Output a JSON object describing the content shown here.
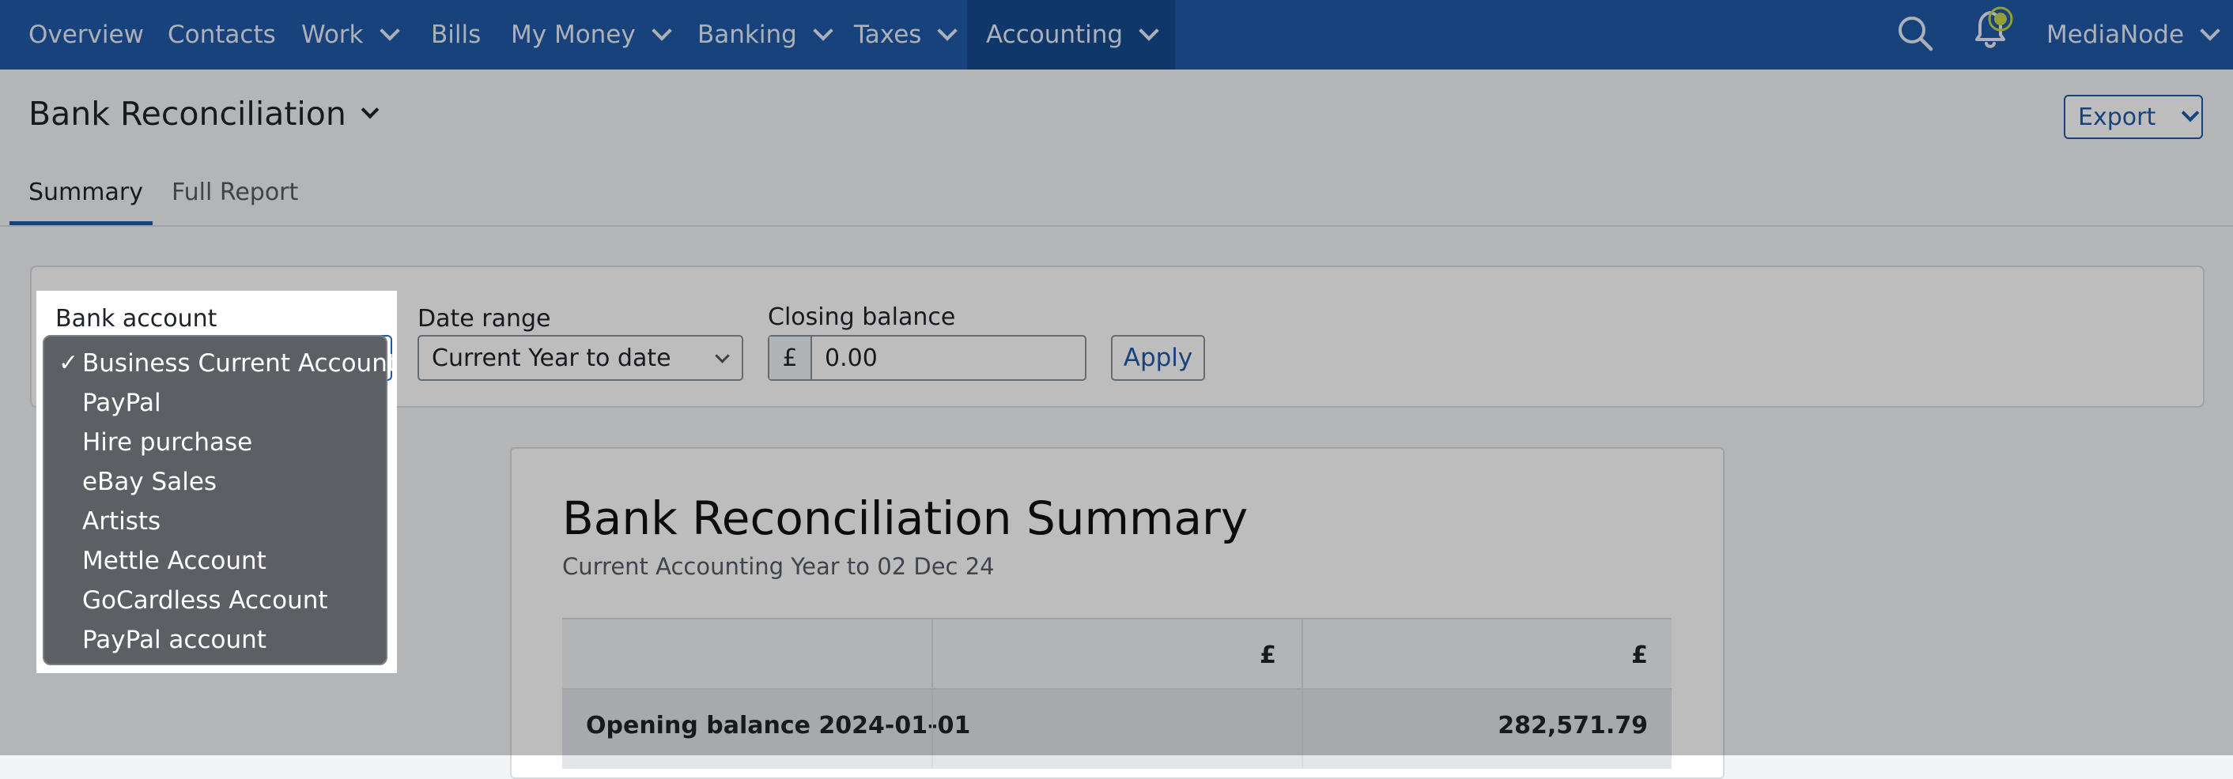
{
  "nav": {
    "items": [
      {
        "label": "Overview",
        "dropdown": false
      },
      {
        "label": "Contacts",
        "dropdown": false
      },
      {
        "label": "Work",
        "dropdown": true
      },
      {
        "label": "Bills",
        "dropdown": false
      },
      {
        "label": "My Money",
        "dropdown": true
      },
      {
        "label": "Banking",
        "dropdown": true
      },
      {
        "label": "Taxes",
        "dropdown": true
      },
      {
        "label": "Accounting",
        "dropdown": true,
        "active": true
      }
    ],
    "account_name": "MediaNode",
    "icons": [
      "search-icon",
      "bell-icon"
    ]
  },
  "page": {
    "title": "Bank Reconciliation",
    "export_label": "Export",
    "tabs": [
      {
        "label": "Summary",
        "active": true
      },
      {
        "label": "Full Report",
        "active": false
      }
    ]
  },
  "filters": {
    "bank_account_label": "Bank account",
    "date_range_label": "Date range",
    "date_range_value": "Current Year to date",
    "closing_balance_label": "Closing balance",
    "currency_symbol": "£",
    "closing_balance_value": "0.00",
    "apply_label": "Apply"
  },
  "bank_account_dropdown": {
    "check_mark": "✓",
    "selected": "Business Current Account",
    "options": [
      "Business Current Account",
      "PayPal",
      "Hire purchase",
      "eBay Sales",
      "Artists",
      "Mettle Account",
      "GoCardless Account",
      "PayPal account"
    ]
  },
  "report": {
    "title": "Bank Reconciliation Summary",
    "subtitle": "Current Accounting Year to 02 Dec 24",
    "columns": [
      "",
      "£",
      "£"
    ],
    "rows": [
      {
        "label": "Opening balance 2024-01-01",
        "col1": "",
        "col2": "282,571.79"
      }
    ]
  },
  "colors": {
    "nav_bg": "#1f5aa6",
    "nav_active_bg": "#164b8e",
    "accent": "#1f5aa6",
    "notification_badge": "#c9d64a"
  }
}
